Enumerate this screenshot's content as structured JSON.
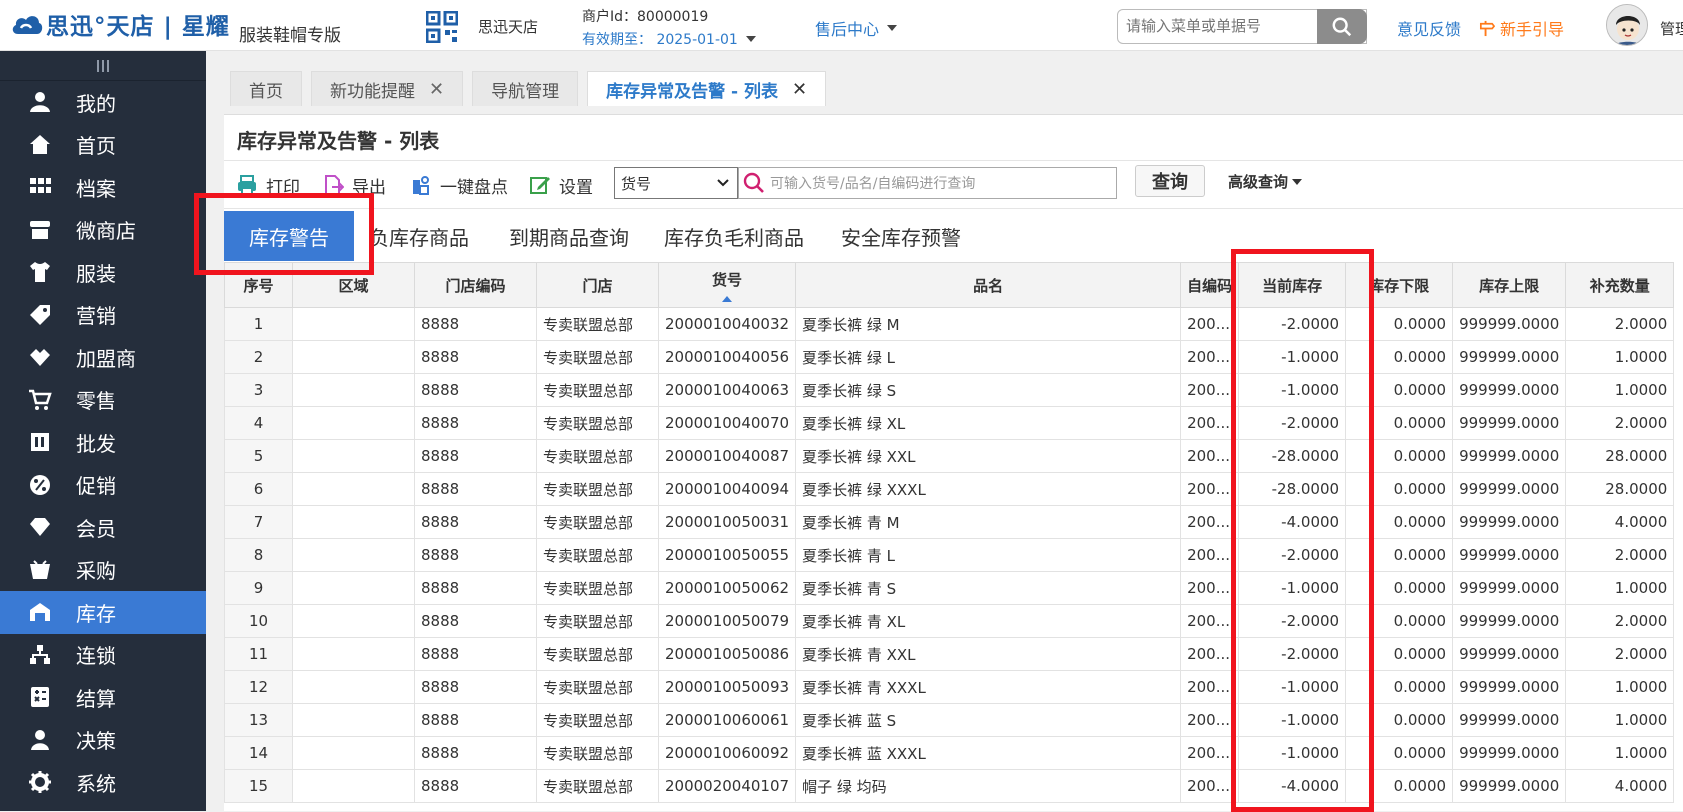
{
  "brand": {
    "name": "思迅°天店 | 星耀",
    "edition": "服装鞋帽专版",
    "color": "#1f5fa8"
  },
  "header": {
    "shop_name": "思迅天店",
    "merchant_id": "商户Id：80000019",
    "expiry": "有效期至： 2025-01-01",
    "after_sale": "售后中心",
    "search_placeholder": "请输入菜单或单据号",
    "feedback": "意见反馈",
    "guide": "新手引导",
    "admin": "管理"
  },
  "sidebar": {
    "accent": "#3a7ad4",
    "items": [
      {
        "label": "我的",
        "icon": "user-icon"
      },
      {
        "label": "首页",
        "icon": "home-icon"
      },
      {
        "label": "档案",
        "icon": "grid-icon"
      },
      {
        "label": "微商店",
        "icon": "store-icon"
      },
      {
        "label": "服装",
        "icon": "shirt-icon"
      },
      {
        "label": "营销",
        "icon": "tag-icon"
      },
      {
        "label": "加盟商",
        "icon": "handshake-icon"
      },
      {
        "label": "零售",
        "icon": "cart-icon"
      },
      {
        "label": "批发",
        "icon": "warehouse-icon"
      },
      {
        "label": "促销",
        "icon": "percent-icon"
      },
      {
        "label": "会员",
        "icon": "diamond-icon"
      },
      {
        "label": "采购",
        "icon": "basket-icon"
      },
      {
        "label": "库存",
        "icon": "stock-icon",
        "active": true
      },
      {
        "label": "连锁",
        "icon": "org-icon"
      },
      {
        "label": "结算",
        "icon": "calc-icon"
      },
      {
        "label": "决策",
        "icon": "person-icon"
      },
      {
        "label": "系统",
        "icon": "gear-icon"
      }
    ]
  },
  "tabs": [
    {
      "label": "首页",
      "closable": false
    },
    {
      "label": "新功能提醒",
      "closable": true
    },
    {
      "label": "导航管理",
      "closable": false
    },
    {
      "label": "库存异常及告警 - 列表",
      "closable": true,
      "active": true
    }
  ],
  "page": {
    "title": "库存异常及告警 - 列表",
    "toolbar": {
      "print": "打印",
      "export": "导出",
      "stocktake": "一键盘点",
      "settings": "设置",
      "select_value": "货号",
      "query_placeholder": "可输入货号/品名/自编码进行查询",
      "query": "查询",
      "advanced": "高级查询"
    },
    "subtabs": [
      {
        "label": "库存警告",
        "active": true
      },
      {
        "label": "负库存商品"
      },
      {
        "label": "到期商品查询"
      },
      {
        "label": "库存负毛利商品"
      },
      {
        "label": "安全库存预警"
      }
    ]
  },
  "table": {
    "columns": [
      "序号",
      "区域",
      "门店编码",
      "门店",
      "货号",
      "品名",
      "自编码",
      "当前库存",
      "库存下限",
      "库存上限",
      "补充数量"
    ],
    "rows": [
      [
        "1",
        "",
        "8888",
        "专卖联盟总部",
        "2000010040032",
        "夏季长裤 绿 M",
        "200...",
        "-2.0000",
        "0.0000",
        "999999.0000",
        "2.0000"
      ],
      [
        "2",
        "",
        "8888",
        "专卖联盟总部",
        "2000010040056",
        "夏季长裤 绿 L",
        "200...",
        "-1.0000",
        "0.0000",
        "999999.0000",
        "1.0000"
      ],
      [
        "3",
        "",
        "8888",
        "专卖联盟总部",
        "2000010040063",
        "夏季长裤 绿 S",
        "200...",
        "-1.0000",
        "0.0000",
        "999999.0000",
        "1.0000"
      ],
      [
        "4",
        "",
        "8888",
        "专卖联盟总部",
        "2000010040070",
        "夏季长裤 绿 XL",
        "200...",
        "-2.0000",
        "0.0000",
        "999999.0000",
        "2.0000"
      ],
      [
        "5",
        "",
        "8888",
        "专卖联盟总部",
        "2000010040087",
        "夏季长裤 绿 XXL",
        "200...",
        "-28.0000",
        "0.0000",
        "999999.0000",
        "28.0000"
      ],
      [
        "6",
        "",
        "8888",
        "专卖联盟总部",
        "2000010040094",
        "夏季长裤 绿 XXXL",
        "200...",
        "-28.0000",
        "0.0000",
        "999999.0000",
        "28.0000"
      ],
      [
        "7",
        "",
        "8888",
        "专卖联盟总部",
        "2000010050031",
        "夏季长裤 青 M",
        "200...",
        "-4.0000",
        "0.0000",
        "999999.0000",
        "4.0000"
      ],
      [
        "8",
        "",
        "8888",
        "专卖联盟总部",
        "2000010050055",
        "夏季长裤 青 L",
        "200...",
        "-2.0000",
        "0.0000",
        "999999.0000",
        "2.0000"
      ],
      [
        "9",
        "",
        "8888",
        "专卖联盟总部",
        "2000010050062",
        "夏季长裤 青 S",
        "200...",
        "-1.0000",
        "0.0000",
        "999999.0000",
        "1.0000"
      ],
      [
        "10",
        "",
        "8888",
        "专卖联盟总部",
        "2000010050079",
        "夏季长裤 青 XL",
        "200...",
        "-2.0000",
        "0.0000",
        "999999.0000",
        "2.0000"
      ],
      [
        "11",
        "",
        "8888",
        "专卖联盟总部",
        "2000010050086",
        "夏季长裤 青 XXL",
        "200...",
        "-2.0000",
        "0.0000",
        "999999.0000",
        "2.0000"
      ],
      [
        "12",
        "",
        "8888",
        "专卖联盟总部",
        "2000010050093",
        "夏季长裤 青 XXXL",
        "200...",
        "-1.0000",
        "0.0000",
        "999999.0000",
        "1.0000"
      ],
      [
        "13",
        "",
        "8888",
        "专卖联盟总部",
        "2000010060061",
        "夏季长裤 蓝 S",
        "200...",
        "-1.0000",
        "0.0000",
        "999999.0000",
        "1.0000"
      ],
      [
        "14",
        "",
        "8888",
        "专卖联盟总部",
        "2000010060092",
        "夏季长裤 蓝 XXXL",
        "200...",
        "-1.0000",
        "0.0000",
        "999999.0000",
        "1.0000"
      ],
      [
        "15",
        "",
        "8888",
        "专卖联盟总部",
        "2000020040107",
        "帽子 绿 均码",
        "200...",
        "-4.0000",
        "0.0000",
        "999999.0000",
        "4.0000"
      ]
    ]
  },
  "highlight_color": "#f0141e"
}
